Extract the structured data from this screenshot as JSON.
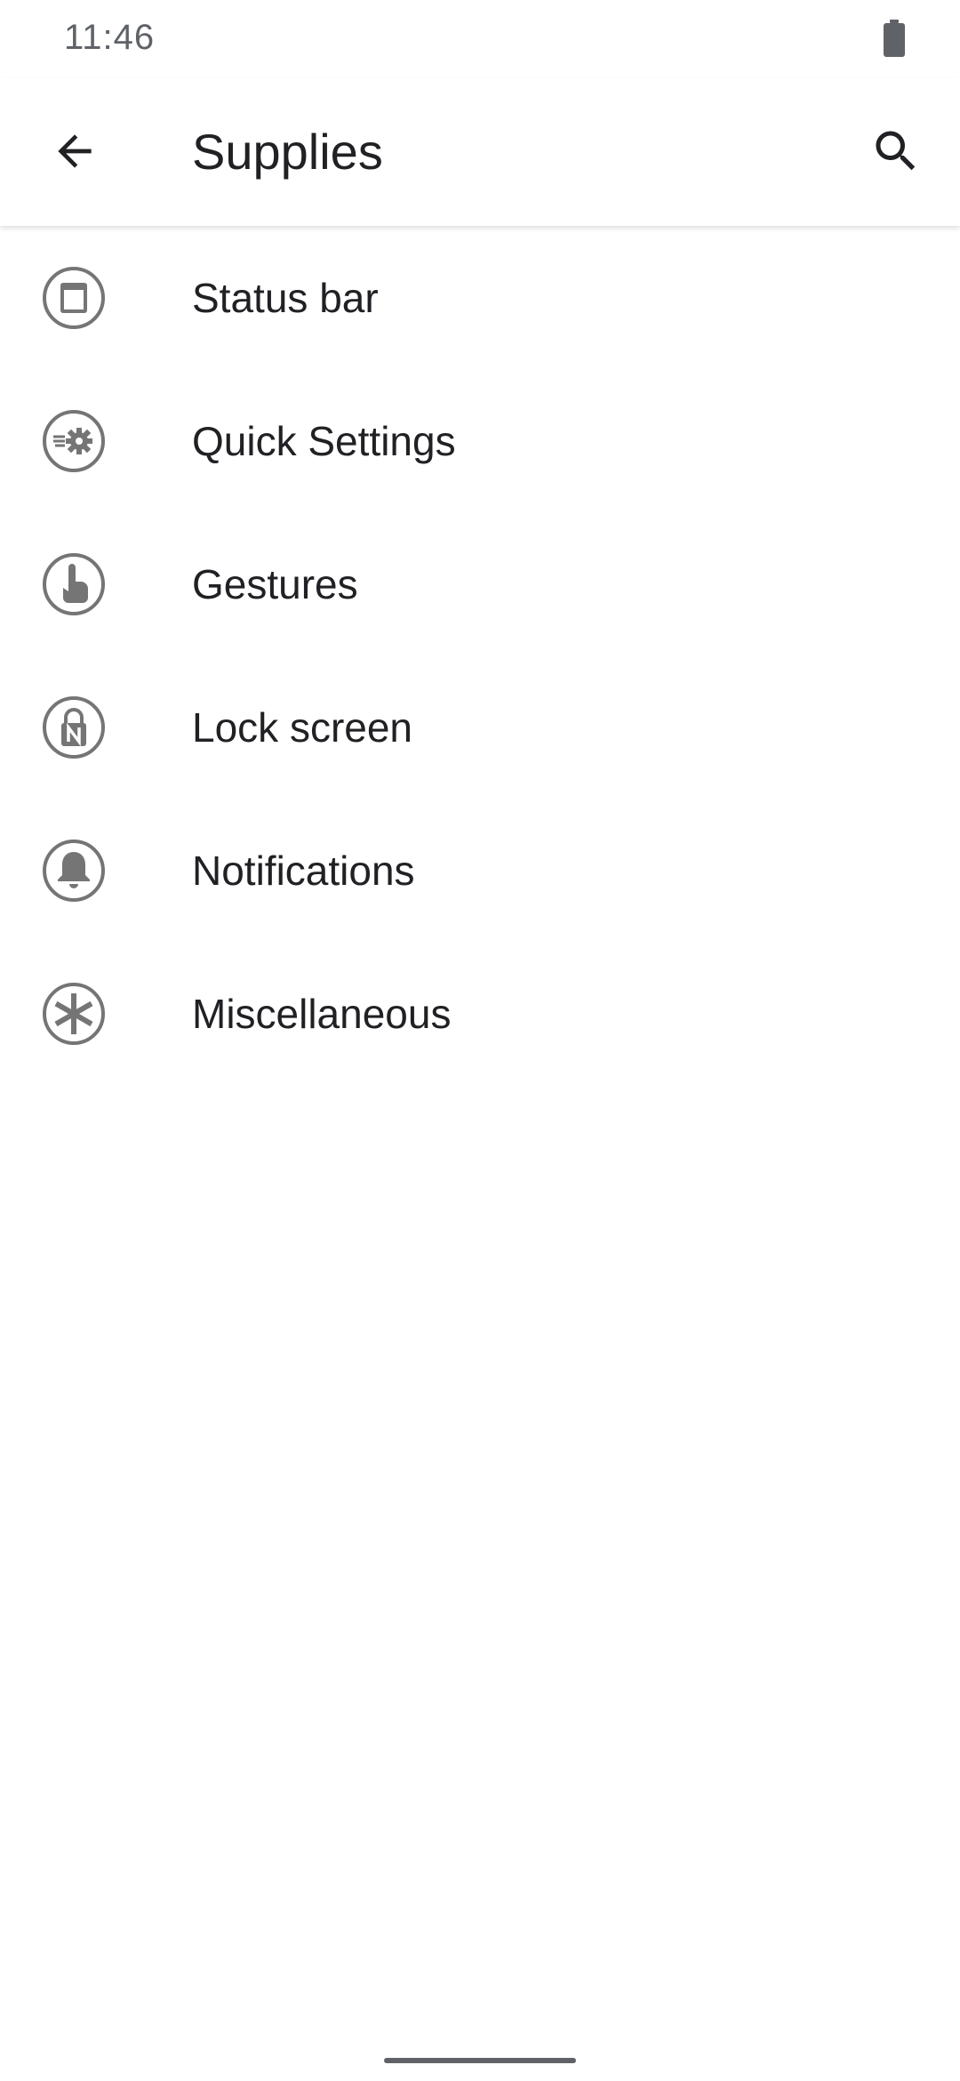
{
  "status_bar": {
    "time": "11:46",
    "battery_icon": "battery-icon"
  },
  "app_bar": {
    "back_icon": "arrow-back-icon",
    "title": "Supplies",
    "search_icon": "search-icon"
  },
  "menu": {
    "items": [
      {
        "label": "Status bar",
        "icon": "status-bar-icon"
      },
      {
        "label": "Quick Settings",
        "icon": "quick-settings-icon"
      },
      {
        "label": "Gestures",
        "icon": "gesture-icon"
      },
      {
        "label": "Lock screen",
        "icon": "lock-screen-icon"
      },
      {
        "label": "Notifications",
        "icon": "bell-icon"
      },
      {
        "label": "Miscellaneous",
        "icon": "asterisk-icon"
      }
    ]
  },
  "colors": {
    "icon_gray": "#757575",
    "text_primary": "#202124",
    "text_secondary": "#5f6368",
    "background": "#ffffff"
  }
}
